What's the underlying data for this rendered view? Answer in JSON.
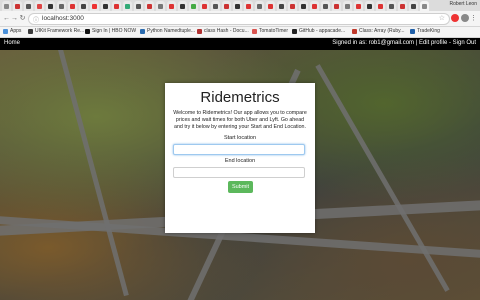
{
  "browser": {
    "profile_name": "Robert Leon",
    "url": "localhost:3000",
    "bookmarks": [
      {
        "label": "Apps",
        "color": "#4a90d9"
      },
      {
        "label": "UIKit Framework Re...",
        "color": "#3a3a3a"
      },
      {
        "label": "Sign In | HBO NOW",
        "color": "#111111"
      },
      {
        "label": "Python Namedtuple...",
        "color": "#2b6cb0"
      },
      {
        "label": "class Hash - Docu...",
        "color": "#b03030"
      },
      {
        "label": "TomatoTimer",
        "color": "#d9534f"
      },
      {
        "label": "GitHub - appacade...",
        "color": "#222222"
      },
      {
        "label": "Class: Array (Ruby...",
        "color": "#c0392b"
      },
      {
        "label": "TradeKing",
        "color": "#1f5fa8"
      }
    ]
  },
  "navbar": {
    "home": "Home",
    "signed_in": "Signed in as: rob1@gmail.com",
    "separator": " | ",
    "edit_profile": "Edit profile",
    "dash": " - ",
    "sign_out": "Sign Out"
  },
  "card": {
    "title": "Ridemetrics",
    "description": "Welcome to Ridemetrics! Our app allows you to compare prices and wait times for both Uber and Lyft. Go ahead and try it below by entering your Start and End Location.",
    "start_label": "Start location",
    "start_value": "",
    "end_label": "End location",
    "end_value": "",
    "submit": "Submit"
  }
}
